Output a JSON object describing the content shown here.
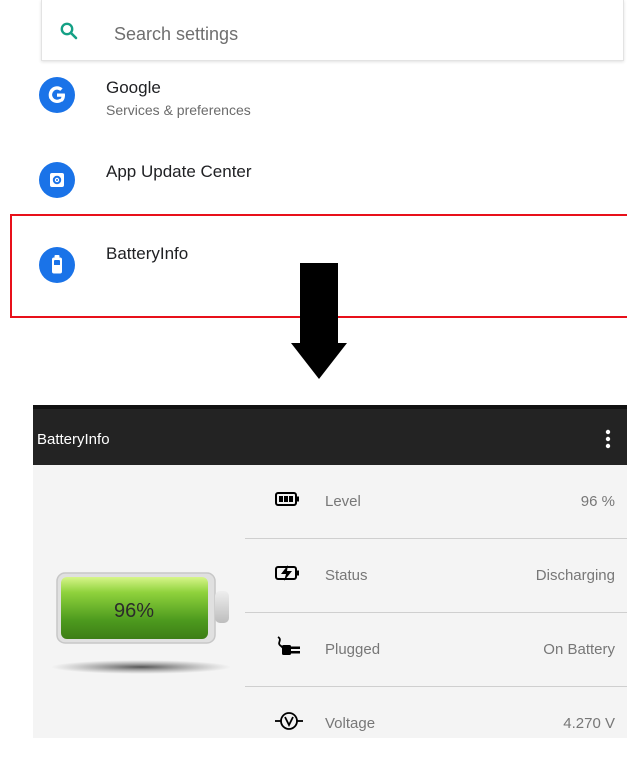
{
  "settings": {
    "search_placeholder": "Search settings",
    "items": [
      {
        "title": "Google",
        "subtitle": "Services & preferences",
        "icon": "google-icon"
      },
      {
        "title": "App Update Center",
        "subtitle": "",
        "icon": "app-update-icon"
      },
      {
        "title": "BatteryInfo",
        "subtitle": "",
        "icon": "battery-icon"
      }
    ]
  },
  "app": {
    "title": "BatteryInfo",
    "battery_percent_label": "96%",
    "rows": [
      {
        "label": "Level",
        "value": "96 %",
        "icon": "battery-level-icon"
      },
      {
        "label": "Status",
        "value": "Discharging",
        "icon": "charging-status-icon"
      },
      {
        "label": "Plugged",
        "value": "On Battery",
        "icon": "plug-icon"
      },
      {
        "label": "Voltage",
        "value": "4.270 V",
        "icon": "voltage-icon"
      }
    ]
  },
  "colors": {
    "accent_blue": "#1a73e8",
    "highlight_red": "#e8101a",
    "toolbar": "#232323",
    "battery_green": "#5cb82a"
  }
}
